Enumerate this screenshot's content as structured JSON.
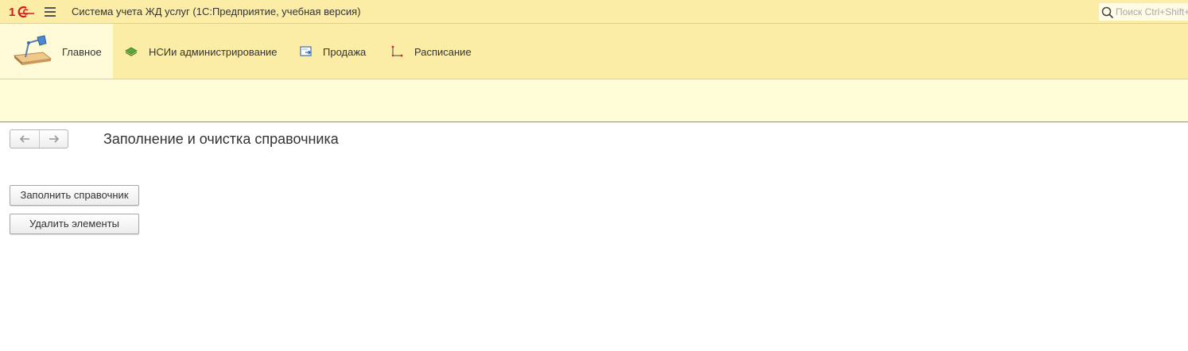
{
  "titlebar": {
    "logo": "1C",
    "menu_icon": "hamburger-menu-icon",
    "title": "Система учета ЖД услуг  (1С:Предприятие, учебная версия)",
    "search": {
      "placeholder": "Поиск Ctrl+Shift+F",
      "icon": "search-icon"
    }
  },
  "sections": [
    {
      "label": "Главное",
      "icon": "desktop-lamp-icon",
      "active": true
    },
    {
      "label": "НСИи администрирование",
      "icon": "layers-icon"
    },
    {
      "label": "Продажа",
      "icon": "sales-document-icon"
    },
    {
      "label": "Расписание",
      "icon": "axes-chart-icon"
    }
  ],
  "form": {
    "title": "Заполнение и очистка справочника",
    "nav": {
      "back_icon": "arrow-left-icon",
      "forward_icon": "arrow-right-icon"
    },
    "buttons": {
      "fill": "Заполнить справочник",
      "delete": "Удалить элементы"
    }
  },
  "colors": {
    "panel_yellow": "#fbeca6",
    "active_section": "#fffbd8",
    "subpanel": "#fffdd8",
    "logo_red": "#d6191b"
  }
}
